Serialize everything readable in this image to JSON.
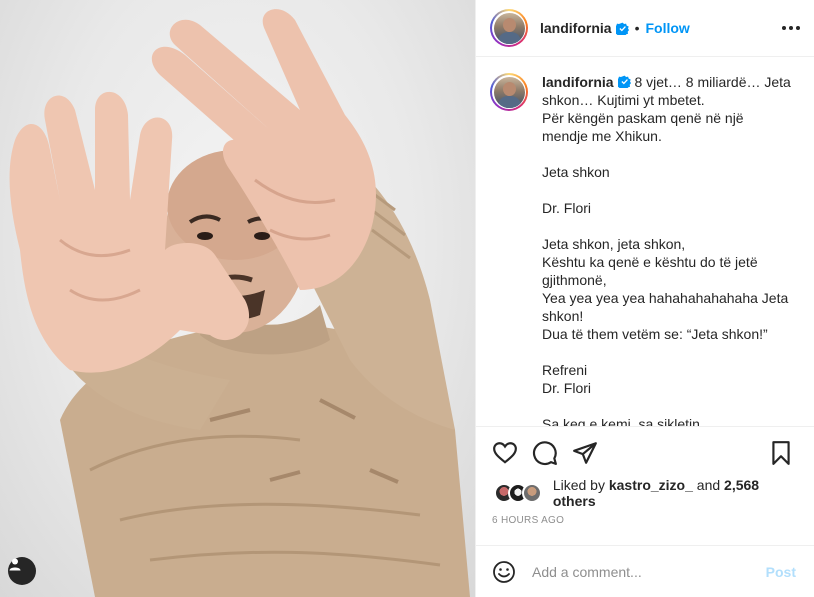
{
  "post": {
    "username": "landifornia",
    "verified": true,
    "dot": "•",
    "follow_label": "Follow",
    "more_icon": "more-horizontal-icon"
  },
  "caption": {
    "username": "landifornia",
    "first_line": " 8 vjet… 8 miliardë… Jeta",
    "lines": [
      "shkon… Kujtimi yt mbetet.",
      "Për këngën paskam qenë në një",
      "mendje me Xhikun.",
      "",
      "Jeta shkon",
      "",
      "Dr. Flori",
      "",
      "Jeta shkon, jeta shkon,",
      "Kështu ka qenë e kështu do të jetë",
      "gjithmonë,",
      "Yea yea yea yea hahahahahahaha Jeta",
      "shkon!",
      "Dua të them vetëm se: “Jeta shkon!”",
      "",
      "Refreni",
      "Dr. Flori",
      "",
      "Sa keq e kemi, sa sikletin"
    ]
  },
  "actions": {
    "like_icon": "heart-icon",
    "comment_icon": "comment-icon",
    "share_icon": "share-icon",
    "save_icon": "bookmark-icon"
  },
  "likes": {
    "prefix": "Liked by ",
    "user": "kastro_zizo_",
    "middle": " and ",
    "others": "2,568 others"
  },
  "timestamp": "6 HOURS AGO",
  "comment": {
    "placeholder": "Add a comment...",
    "post_label": "Post"
  },
  "colors": {
    "accent": "#0095f6",
    "post_disabled": "#b2dffc",
    "muted": "#8e8e8e"
  }
}
